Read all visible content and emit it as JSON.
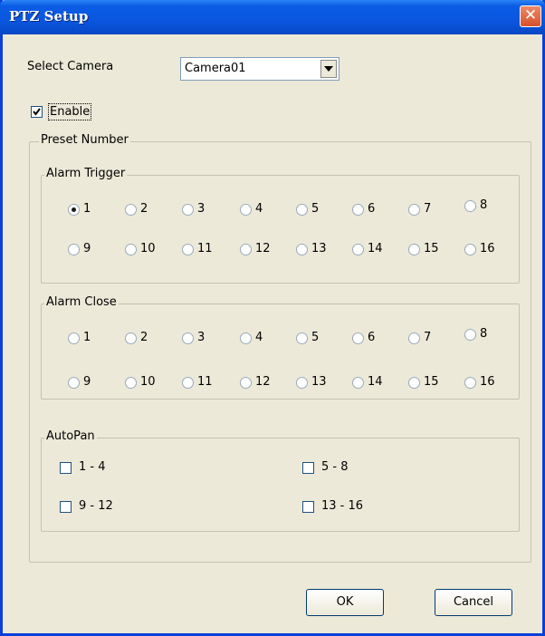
{
  "window": {
    "title": "PTZ Setup",
    "close_glyph": "✕"
  },
  "select_camera": {
    "label": "Select Camera",
    "value": "Camera01"
  },
  "enable": {
    "label": "Enable",
    "checked": true
  },
  "preset_number": {
    "legend": "Preset Number",
    "alarm_trigger": {
      "legend": "Alarm Trigger",
      "selected": "1"
    },
    "alarm_close": {
      "legend": "Alarm Close",
      "selected": null
    },
    "options": [
      "1",
      "2",
      "3",
      "4",
      "5",
      "6",
      "7",
      "8",
      "9",
      "10",
      "11",
      "12",
      "13",
      "14",
      "15",
      "16"
    ]
  },
  "autopan": {
    "legend": "AutoPan",
    "items": [
      {
        "label": "1 - 4",
        "checked": false
      },
      {
        "label": "5 - 8",
        "checked": false
      },
      {
        "label": "9 - 12",
        "checked": false
      },
      {
        "label": "13 - 16",
        "checked": false
      }
    ]
  },
  "buttons": {
    "ok": "OK",
    "cancel": "Cancel"
  }
}
